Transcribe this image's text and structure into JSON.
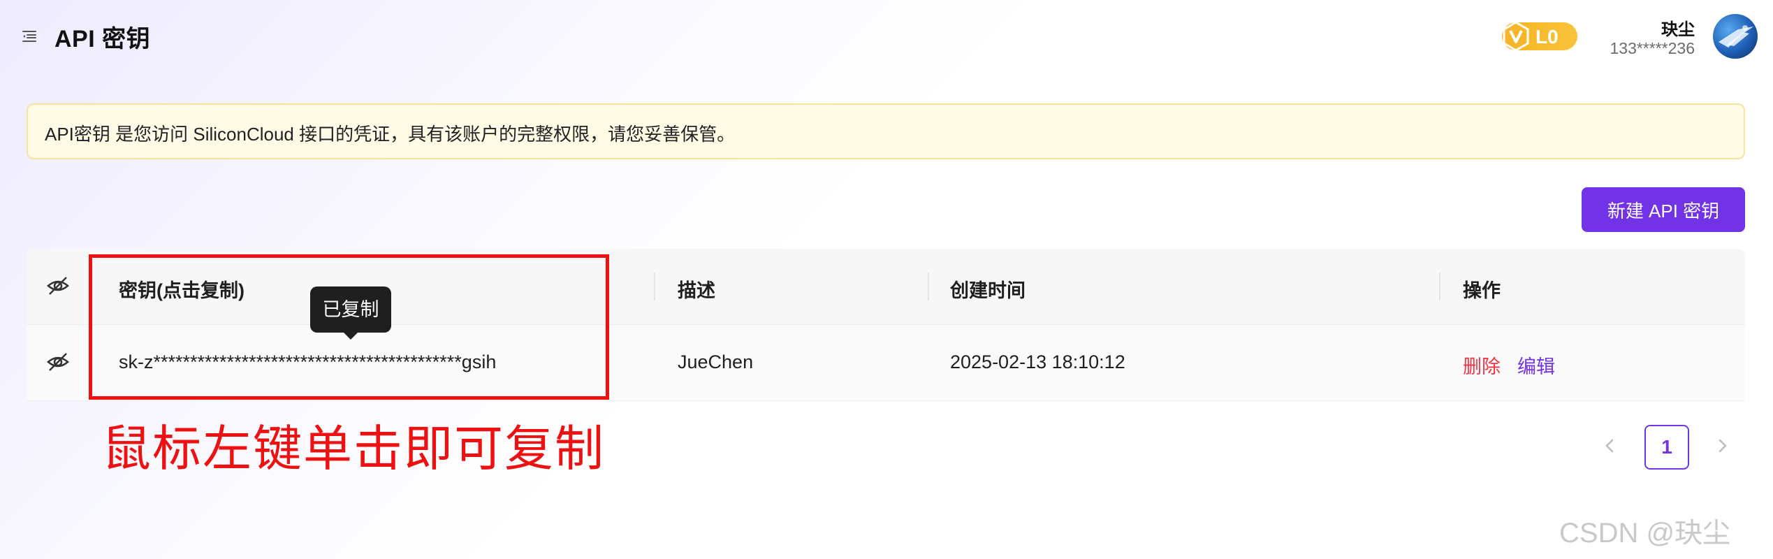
{
  "header": {
    "title": "API 密钥",
    "user": {
      "level": "L0",
      "name": "玦尘",
      "phone": "133*****236"
    }
  },
  "notice": {
    "text": "API密钥 是您访问 SiliconCloud 接口的凭证，具有该账户的完整权限，请您妥善保管。"
  },
  "toolbar": {
    "new_key_label": "新建 API 密钥"
  },
  "table": {
    "headers": {
      "key": "密钥(点击复制)",
      "description": "描述",
      "created": "创建时间",
      "actions": "操作"
    },
    "rows": [
      {
        "key": "sk-z******************************************gsih",
        "description": "JueChen",
        "created": "2025-02-13 18:10:12",
        "delete": "删除",
        "edit": "编辑"
      }
    ]
  },
  "tooltip": {
    "text": "已复制"
  },
  "annotation": {
    "text": "鼠标左键单击即可复制"
  },
  "pagination": {
    "current_page": "1"
  },
  "watermark": {
    "text": "CSDN @玦尘"
  },
  "colors": {
    "accent": "#7232e6",
    "danger": "#ee3344",
    "annotation": "#ee1111",
    "badge": "#f5b421",
    "notice_bg": "#fffbe6"
  }
}
